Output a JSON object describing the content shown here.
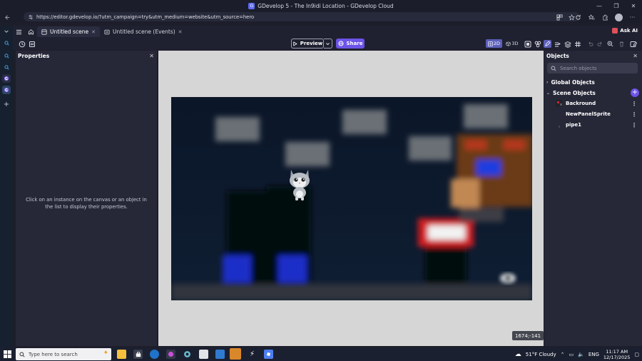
{
  "window": {
    "title": "GDevelop 5 - The In9idi Location - GDevelop Cloud",
    "controls": [
      "—",
      "❐",
      "✕"
    ]
  },
  "browser": {
    "url": "https://editor.gdevelop.io/?utm_campaign=try&utm_medium=website&utm_source=hero"
  },
  "tabs": [
    {
      "label": "Untitled scene"
    },
    {
      "label": "Untitled scene (Events)"
    }
  ],
  "ask_ai": {
    "label": "Ask AI"
  },
  "toolbar": {
    "preview_label": "Preview",
    "share_label": "Share",
    "mode_2d_label": "2D",
    "mode_3d_label": "3D"
  },
  "properties": {
    "title": "Properties",
    "empty_message": "Click on an instance on the canvas or an object in the list to display their properties."
  },
  "canvas": {
    "cursor_coords": "1674;-141"
  },
  "objects": {
    "title": "Objects",
    "search_placeholder": "Search objects",
    "global_group": "Global Objects",
    "scene_group": "Scene Objects",
    "items": [
      {
        "name": "Backround"
      },
      {
        "name": "NewPanelSprite"
      },
      {
        "name": "pipe1"
      }
    ]
  },
  "taskbar": {
    "search_placeholder": "Type here to search",
    "weather": "51°F  Cloudy",
    "time": "11:17 AM",
    "date": "12/17/2025"
  },
  "colors": {
    "accent": "#6c53e8",
    "panel": "#262838",
    "scene_bg": "#0e1a2b"
  }
}
